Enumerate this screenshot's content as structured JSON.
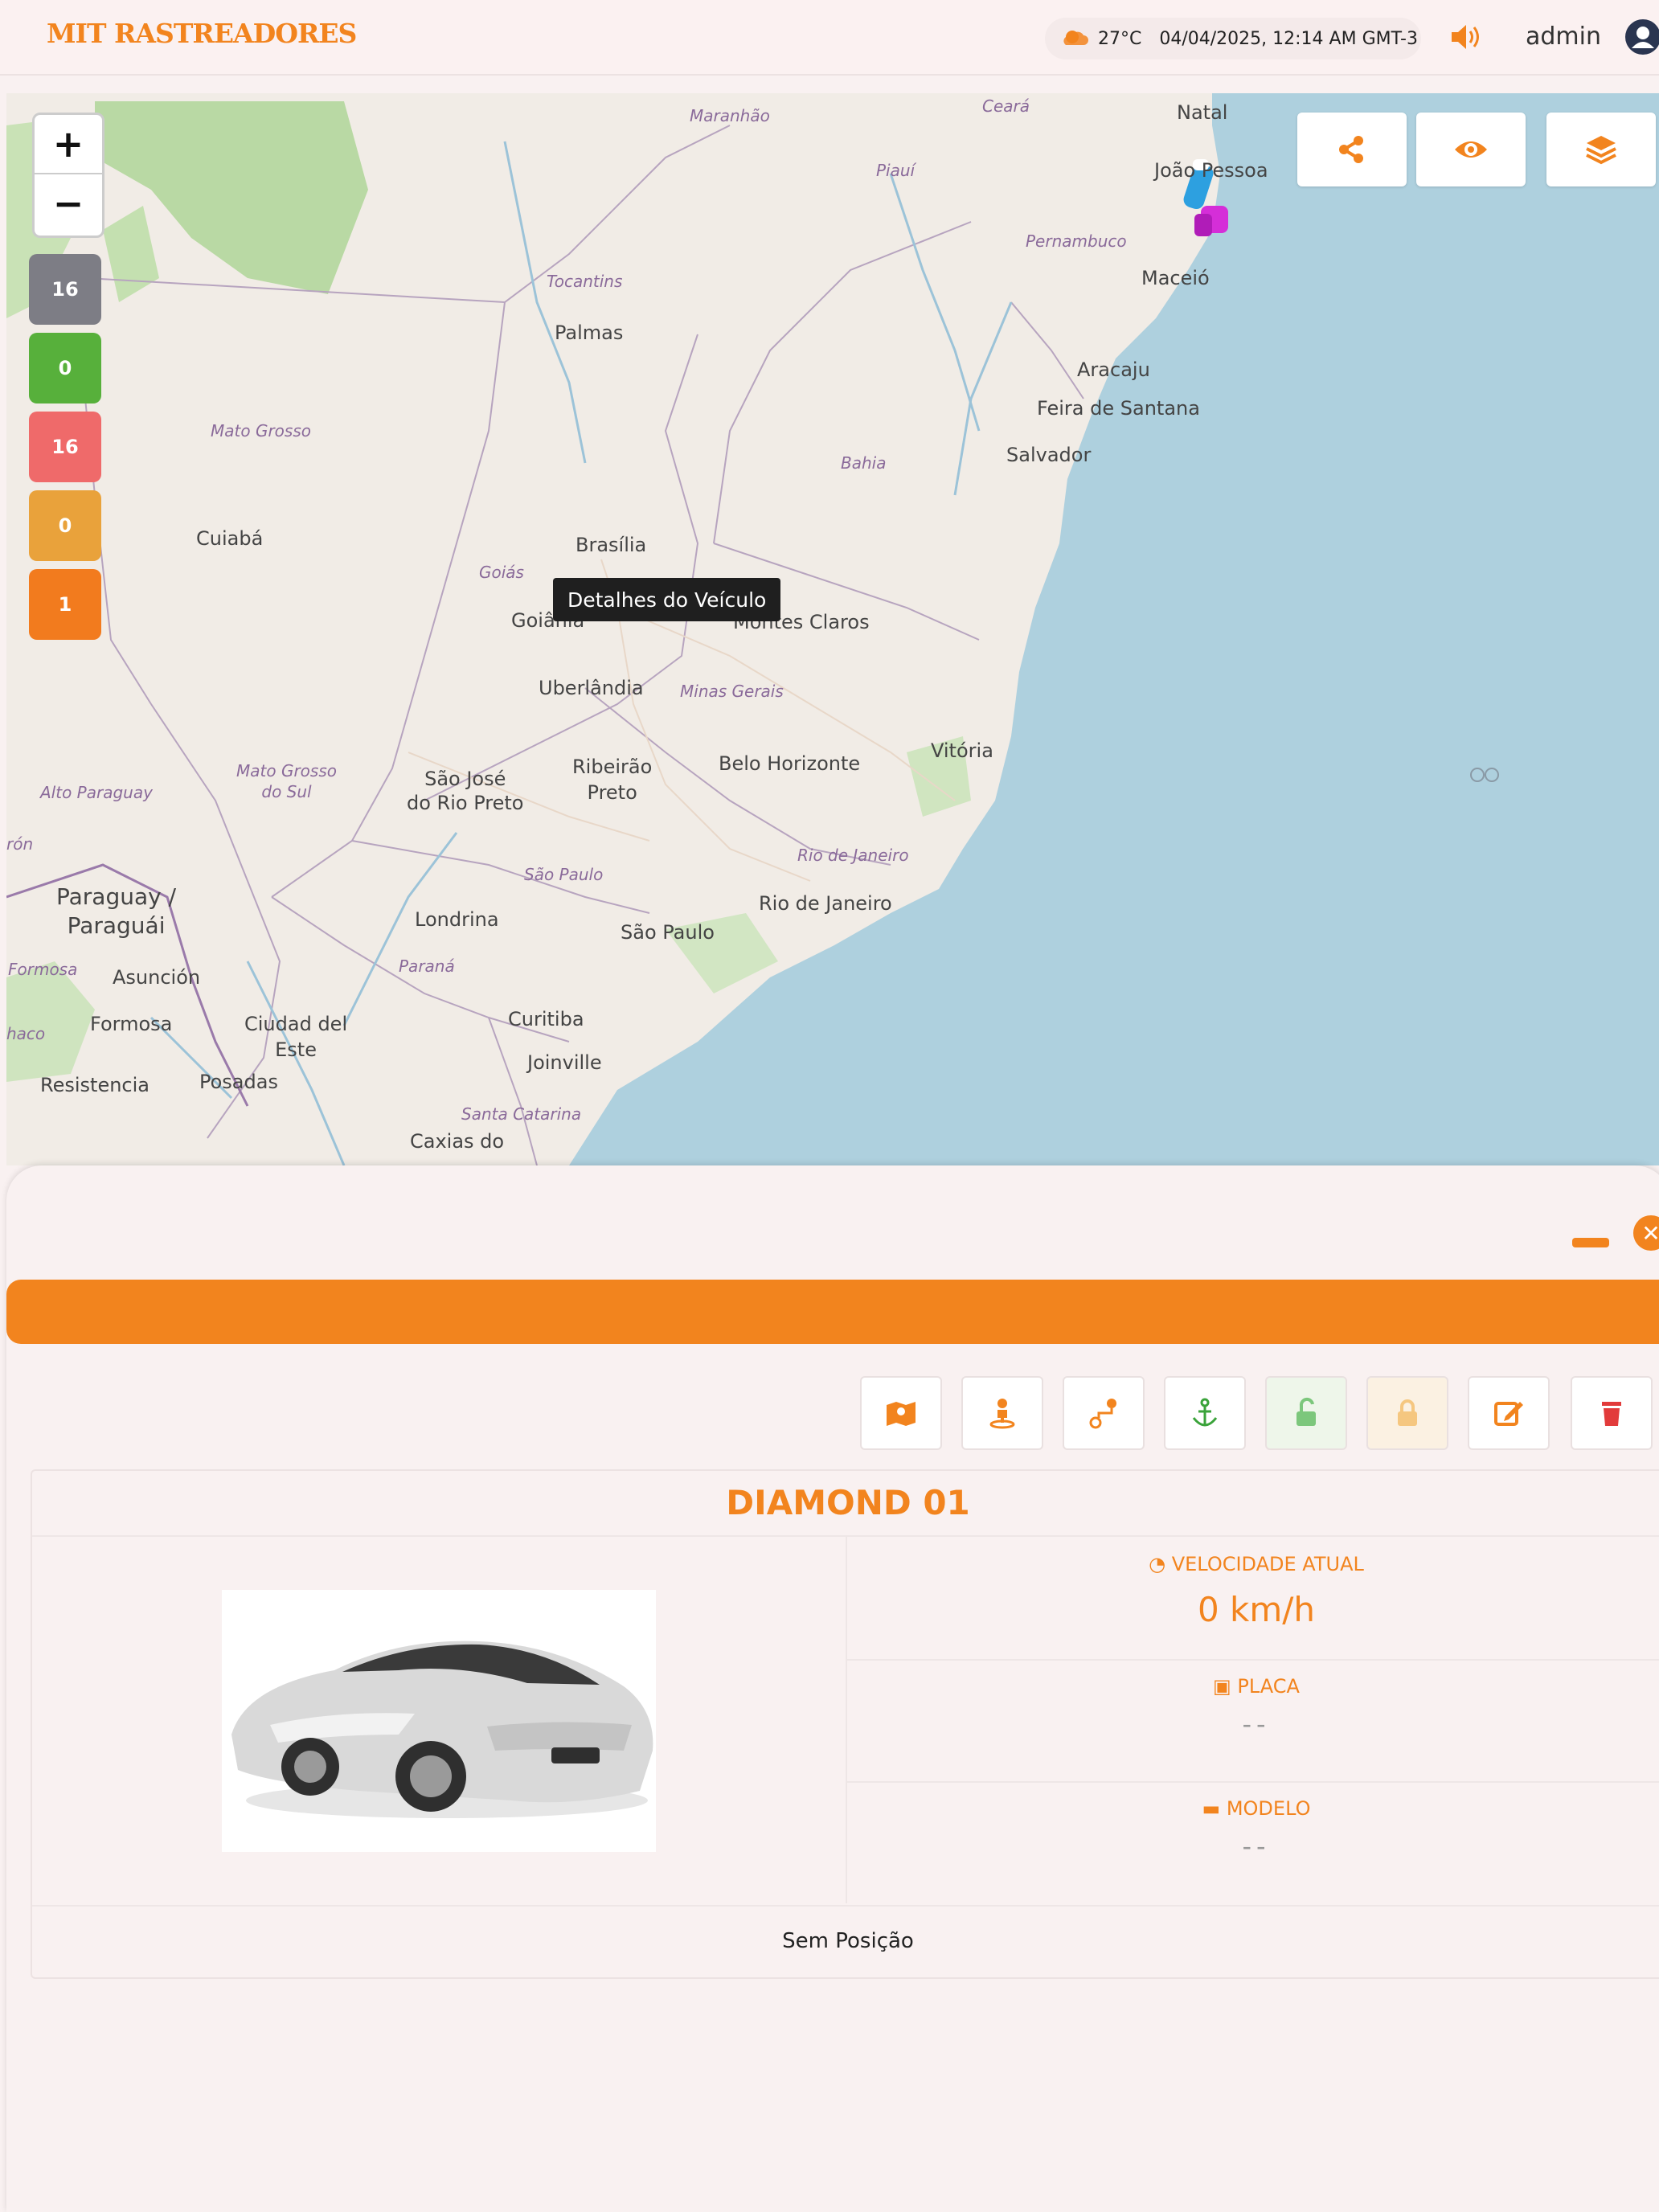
{
  "header": {
    "brand": "MIT RASTREADORES",
    "weather_temp": "27°C",
    "datetime": "04/04/2025, 12:14 AM GMT-3",
    "user_name": "admin",
    "icons": {
      "weather": "partly-cloudy-icon",
      "sound": "volume-icon",
      "user": "user-circle-icon"
    }
  },
  "map": {
    "zoom_in": "+",
    "zoom_out": "−",
    "counters": [
      {
        "value": "16",
        "color": "#7d7d85"
      },
      {
        "value": "0",
        "color": "#57b03b"
      },
      {
        "value": "16",
        "color": "#ef6a6a"
      },
      {
        "value": "0",
        "color": "#e9a23b"
      },
      {
        "value": "1",
        "color": "#f27b1e"
      }
    ],
    "tools": [
      "share-icon",
      "eye-icon",
      "layers-icon"
    ],
    "tooltip": "Detalhes do Veículo",
    "places": {
      "natal": "Natal",
      "joao_pessoa": "João Pessoa",
      "maceio": "Maceió",
      "aracaju": "Aracaju",
      "feira": "Feira de Santana",
      "salvador": "Salvador",
      "palmas": "Palmas",
      "cuiaba": "Cuiabá",
      "brasilia": "Brasília",
      "goiania": "Goiânia",
      "montes_claros": "Montes Claros",
      "uberlandia": "Uberlândia",
      "vitoria": "Vitória",
      "belo_horizonte": "Belo Horizonte",
      "sao_jose": "São José\ndo Rio Preto",
      "ribeirao": "Ribeirão\nPreto",
      "rio": "Rio de Janeiro",
      "sao_paulo": "São Paulo",
      "londrina": "Londrina",
      "curitiba": "Curitiba",
      "joinville": "Joinville",
      "caxias": "Caxias do",
      "paraguay": "Paraguay /\nParaguái",
      "asuncion": "Asunción",
      "formosa": "Formosa",
      "ciudad_este": "Ciudad del\nEste",
      "resistencia": "Resistencia",
      "posadas": "Posadas"
    },
    "regions": {
      "maranhao": "Maranhão",
      "ceara": "Ceará",
      "piaui": "Piauí",
      "pernambuco": "Pernambuco",
      "tocantins": "Tocantins",
      "mato_grosso": "Mato Grosso",
      "bahia": "Bahia",
      "goias": "Goiás",
      "minas": "Minas Gerais",
      "ms": "Mato Grosso\ndo Sul",
      "alto_paraguay": "Alto Paraguay",
      "sp": "São Paulo",
      "rj": "Rio de Janeiro",
      "parana": "Paraná",
      "sc": "Santa Catarina",
      "formosa_r": "Formosa",
      "ron": "rón",
      "chaco": "haco"
    }
  },
  "panel": {
    "actions": [
      {
        "icon": "map-marker-route-icon",
        "color": "#f2841e"
      },
      {
        "icon": "person-pin-icon",
        "color": "#f2841e"
      },
      {
        "icon": "route-icon",
        "color": "#f2841e"
      },
      {
        "icon": "anchor-icon",
        "color": "#3aa33a"
      },
      {
        "icon": "unlock-icon",
        "color": "#5cbf5c"
      },
      {
        "icon": "lock-icon",
        "color": "#f5c24a"
      },
      {
        "icon": "edit-icon",
        "color": "#f2841e"
      },
      {
        "icon": "trash-icon",
        "color": "#e23b3b"
      }
    ],
    "vehicle_name": "DIAMOND 01",
    "speed_label": "VELOCIDADE ATUAL",
    "speed_value": "0 km/h",
    "plate_label": "PLACA",
    "plate_value": "--",
    "model_label": "MODELO",
    "model_value": "--",
    "position_status": "Sem Posição",
    "photo": "car-photo"
  }
}
